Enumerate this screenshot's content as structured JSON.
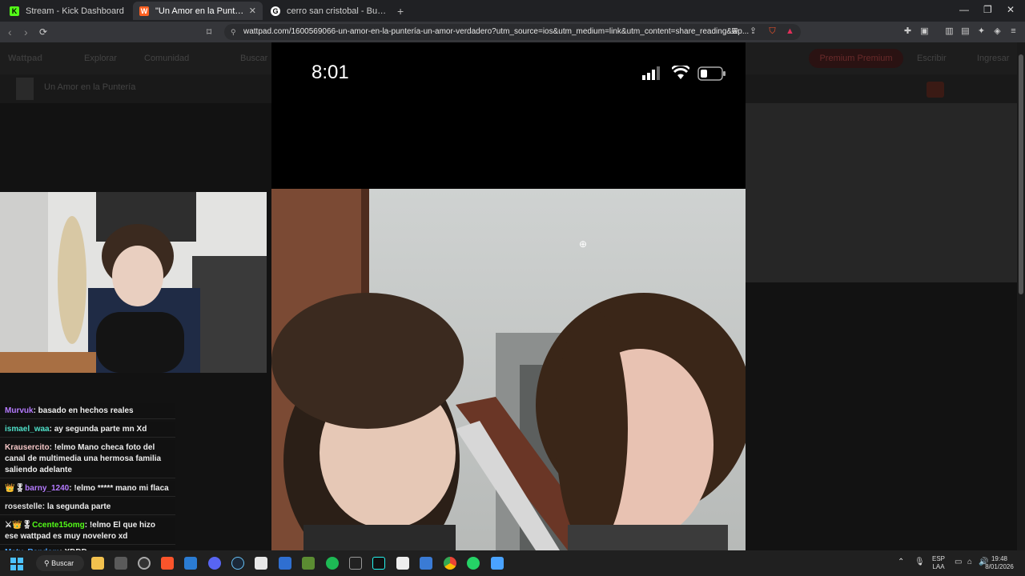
{
  "browser": {
    "tabs": [
      {
        "title": "Stream - Kick Dashboard",
        "favicon_color": "#53fc18",
        "favicon_glyph": "K",
        "active": false
      },
      {
        "title": "\"Un Amor en la Puntería\" - Un am",
        "favicon_color": "#ff6122",
        "favicon_glyph": "W",
        "active": true
      },
      {
        "title": "cerro san cristobal - Buscar con Goo",
        "favicon_color": "#ffffff",
        "favicon_glyph": "G",
        "active": false
      }
    ],
    "new_tab_glyph": "+",
    "url": "wattpad.com/1600569066-un-amor-en-la-puntería-un-amor-verdadero?utm_source=ios&utm_medium=link&utm_content=share_reading&wp...",
    "window_controls": [
      "minimize-icon",
      "maximize-icon",
      "close-icon"
    ]
  },
  "wattpad_dimmed": {
    "nav": [
      "Wattpad",
      "Explorar",
      "Comunidad",
      "Buscar",
      "Premium Premium",
      "Escribir",
      "Ingresar"
    ],
    "subheader": "Un Amor en la Puntería"
  },
  "phone": {
    "time": "8:01",
    "status_icons": [
      "signal-icon",
      "wifi-icon",
      "battery-icon"
    ]
  },
  "chat": {
    "messages": [
      {
        "user": "Murvuk",
        "color": "#b57bff",
        "badges": "",
        "text": "basado en hechos reales"
      },
      {
        "user": "ismael_waa",
        "color": "#4fe0c9",
        "badges": "",
        "text": "ay segunda parte mn Xd"
      },
      {
        "user": "Krausercito",
        "color": "#f6c7c7",
        "badges": "",
        "text": "!elmo Mano checa foto del canal de multimedia una hermosa familia saliendo adelante"
      },
      {
        "user": "barny_1240",
        "color": "#b57bff",
        "badges": "👑🎖",
        "text": "!elmo ***** mano mi flaca"
      },
      {
        "user": "rosestelle",
        "color": "#e0e0e0",
        "badges": "",
        "text": "la segunda parte"
      },
      {
        "user": "Ccente15omg",
        "color": "#53fc18",
        "badges": "⚔👑🎖",
        "text": "!elmo El que hizo ese wattpad es muy novelero xd"
      },
      {
        "user": "Maty_Random",
        "color": "#4aa3ff",
        "badges": "",
        "text": "XDDD"
      }
    ]
  },
  "taskbar": {
    "search_label": "Buscar",
    "apps": [
      "files-icon",
      "store-icon",
      "obs-icon",
      "brave-icon",
      "explorer-icon",
      "discord-icon",
      "steam-icon",
      "notepad-icon",
      "vs-icon",
      "minecraft-icon",
      "spotify-icon",
      "ea-icon",
      "tiktok-icon",
      "capcut-icon",
      "calculator-icon",
      "chrome-icon",
      "whatsapp-icon",
      "notes-icon"
    ],
    "lang_top": "ESP",
    "lang_bottom": "LAA",
    "time": "19:48",
    "date": "8/01/2026"
  },
  "colors": {
    "kick_green": "#53fc18",
    "wattpad_orange": "#ff6122",
    "brave_orange": "#fb542b"
  }
}
